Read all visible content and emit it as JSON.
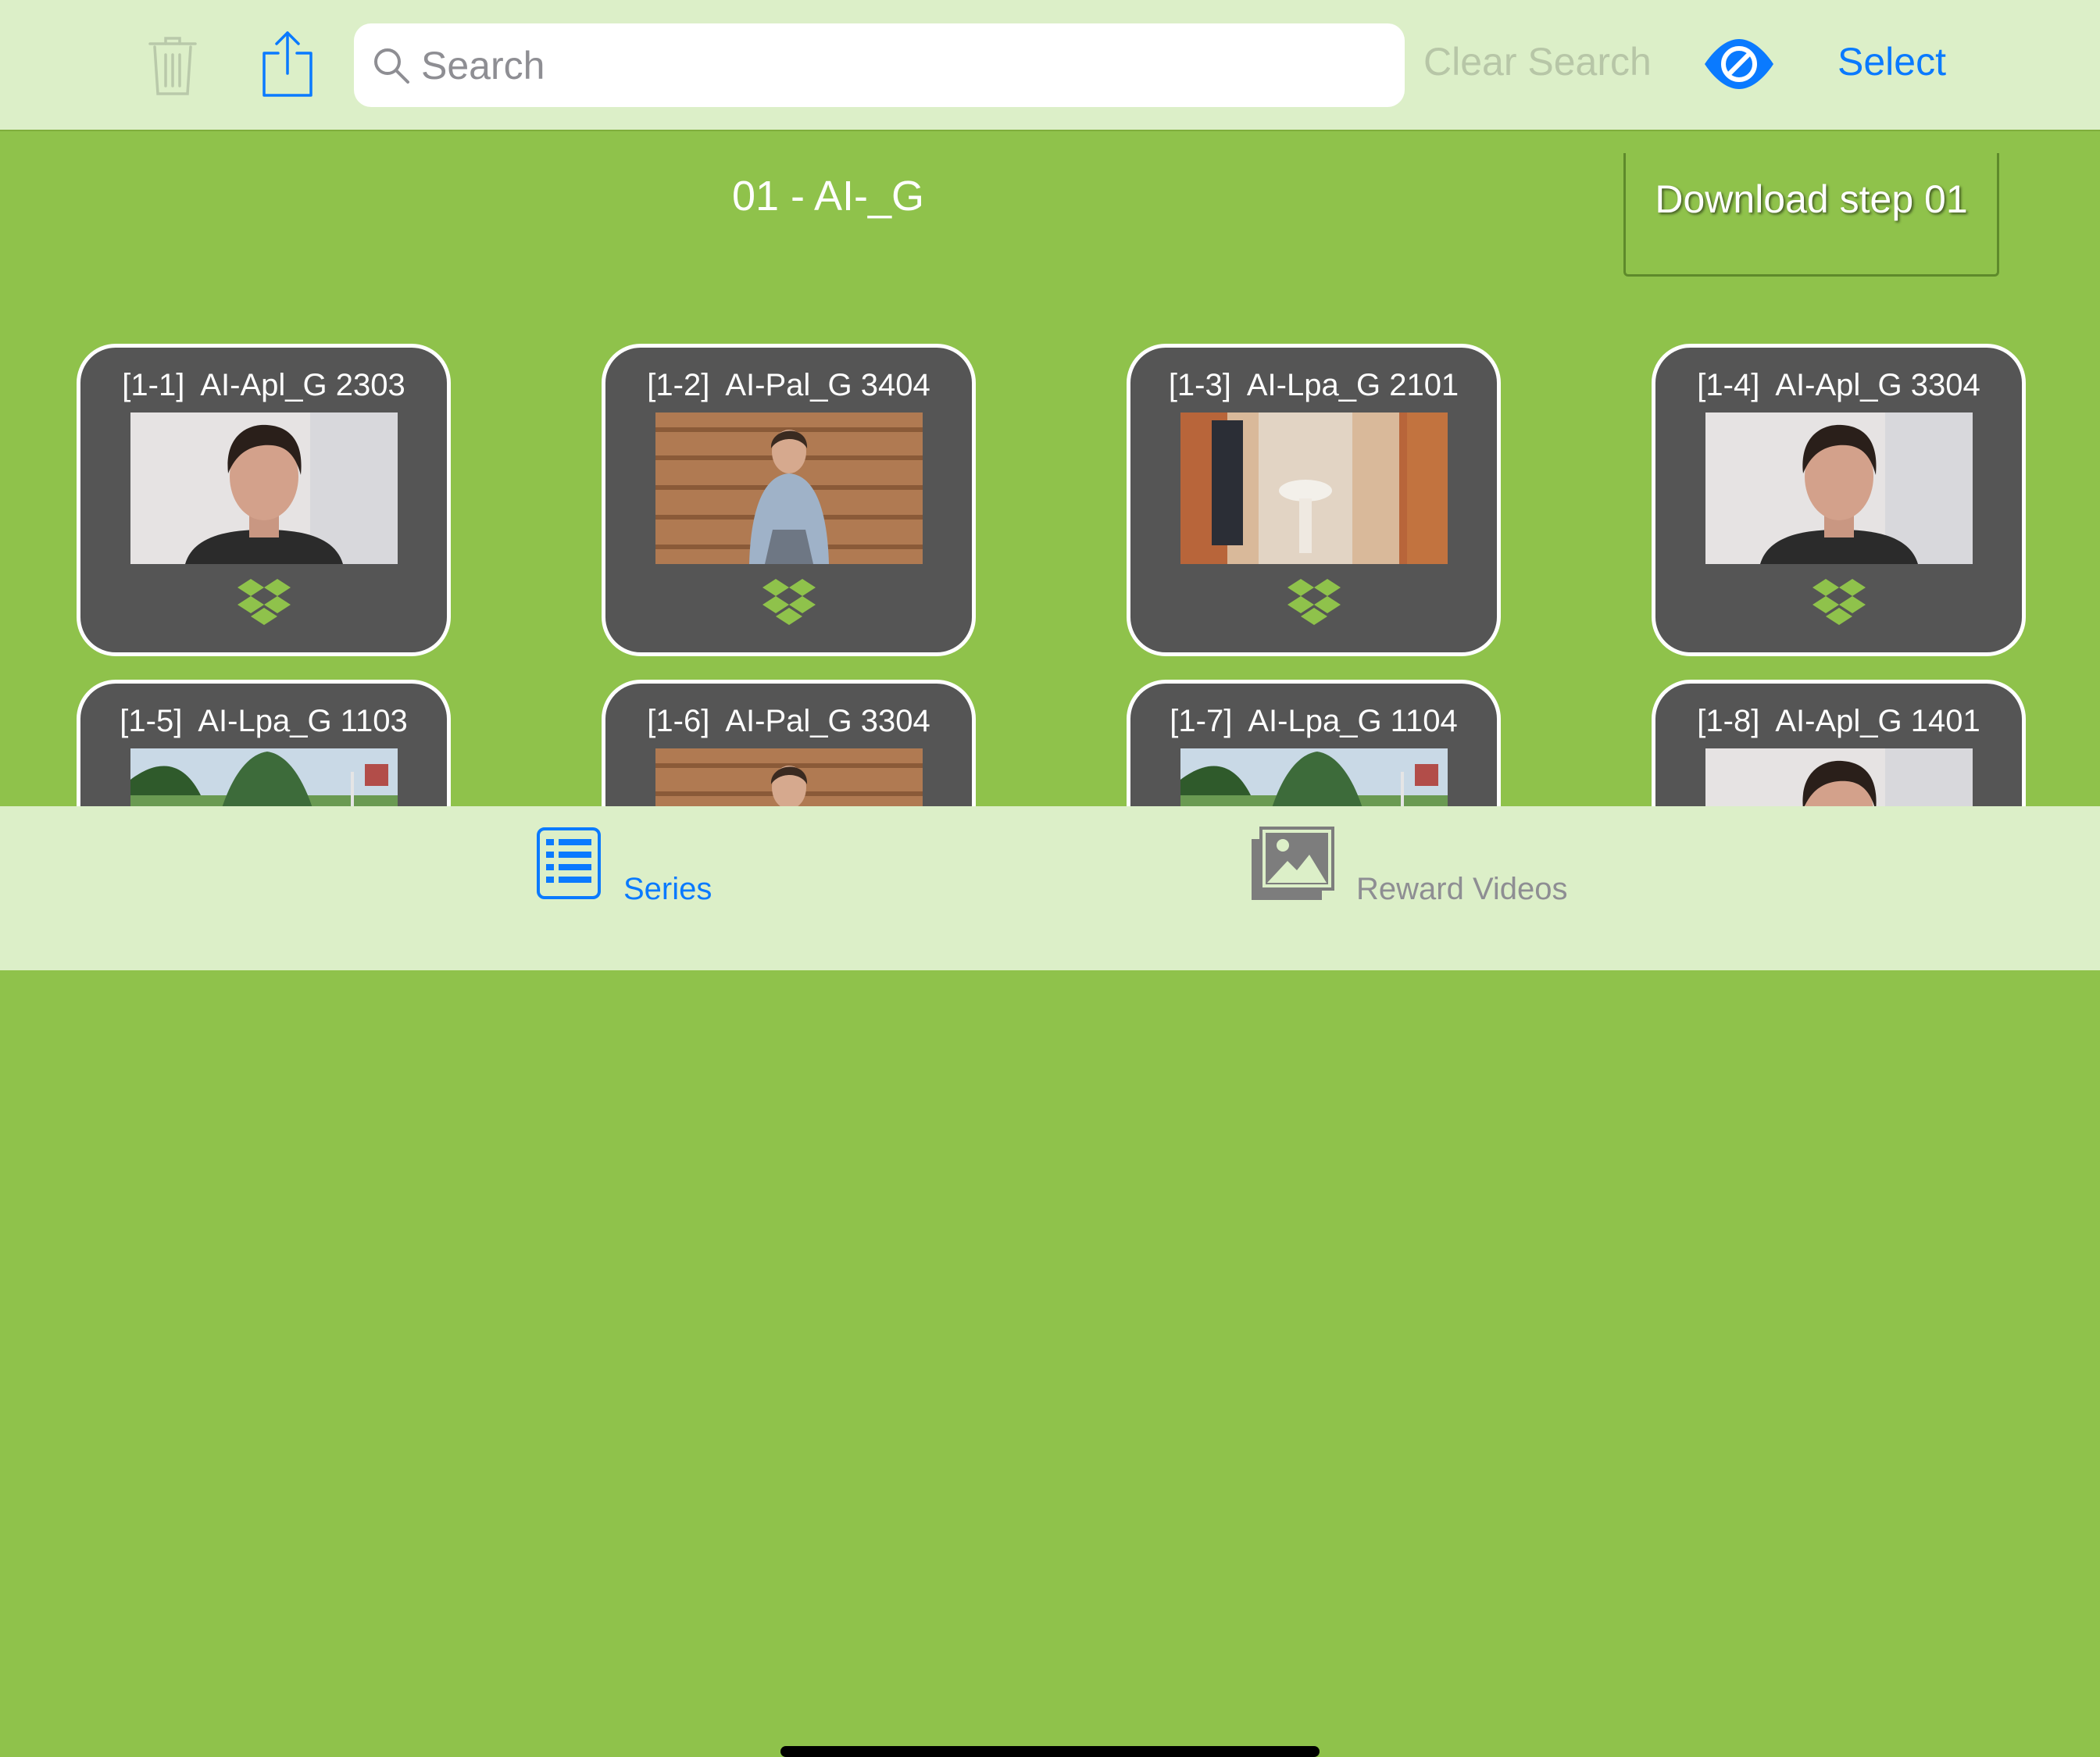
{
  "toolbar": {
    "trash_icon": "trash-icon",
    "share_icon": "share-icon",
    "search_placeholder": "Search",
    "search_value": "",
    "clear_search_label": "Clear Search",
    "visibility_icon": "eye-slash-icon",
    "select_label": "Select"
  },
  "group": {
    "title": "01 - AI-_G",
    "download_label": "Download step 01"
  },
  "cards": [
    {
      "label": "[1-1]  AI-Apl_G 2303",
      "thumb": "man-white-wall"
    },
    {
      "label": "[1-2]  AI-Pal_G 3404",
      "thumb": "man-log-wall"
    },
    {
      "label": "[1-3]  AI-Lpa_G 2101",
      "thumb": "bathroom"
    },
    {
      "label": "[1-4]  AI-Apl_G 3304",
      "thumb": "man-white-wall"
    },
    {
      "label": "[1-5]  AI-Lpa_G 1103",
      "thumb": "garden-tree"
    },
    {
      "label": "[1-6]  AI-Pal_G 3304",
      "thumb": "man-log-wall"
    },
    {
      "label": "[1-7]  AI-Lpa_G 1104",
      "thumb": "garden-tree"
    },
    {
      "label": "[1-8]  AI-Apl_G 1401",
      "thumb": "man-white-wall"
    }
  ],
  "tabs": [
    {
      "label": "Series",
      "icon": "list-icon",
      "selected": true
    },
    {
      "label": "Reward Videos",
      "icon": "photos-icon",
      "selected": false
    }
  ],
  "colors": {
    "accent": "#0a7aff",
    "background": "#8fc24b",
    "bar": "#dcefc8",
    "card": "#555555"
  }
}
